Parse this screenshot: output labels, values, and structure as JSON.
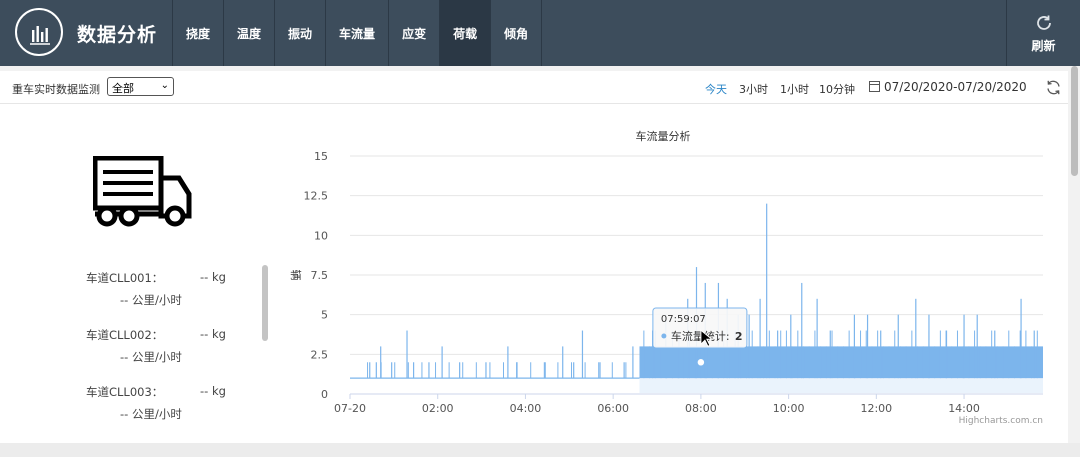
{
  "app": {
    "title": "数据分析",
    "nav": [
      "挠度",
      "温度",
      "振动",
      "车流量",
      "应变",
      "荷载",
      "倾角"
    ],
    "active_nav": "荷载",
    "refresh_label": "刷新"
  },
  "toolbar": {
    "filter_label": "重车实时数据监测",
    "filter_value": "全部",
    "ranges": [
      "今天",
      "3小时",
      "1小时",
      "10分钟"
    ],
    "active_range": "今天",
    "date_range": "07/20/2020-07/20/2020"
  },
  "lanes": [
    {
      "name": "车道CLL001：",
      "weight": "-- kg",
      "speed": "-- 公里/小时"
    },
    {
      "name": "车道CLL002：",
      "weight": "-- kg",
      "speed": "-- 公里/小时"
    },
    {
      "name": "车道CLL003：",
      "weight": "-- kg",
      "speed": "-- 公里/小时"
    }
  ],
  "colors": {
    "topbar": "#3d4d5c",
    "series": "#7cb5ec",
    "active_range": "#2a85c7"
  },
  "chart_data": {
    "type": "area",
    "title": "车流量分析",
    "ylabel": "辆",
    "ylim": [
      0,
      15
    ],
    "yticks": [
      "0",
      "2.5",
      "5",
      "7.5",
      "10",
      "12.5",
      "15"
    ],
    "xticks": [
      "07-20",
      "02:00",
      "04:00",
      "06:00",
      "08:00",
      "10:00",
      "12:00",
      "14:00"
    ],
    "series": [
      {
        "name": "车流量统计"
      }
    ],
    "x_hours_visible": [
      0,
      15.8
    ],
    "baseline": 1,
    "peaks": [
      {
        "x": 0.45,
        "y": 2
      },
      {
        "x": 0.6,
        "y": 2
      },
      {
        "x": 0.7,
        "y": 3
      },
      {
        "x": 0.95,
        "y": 2
      },
      {
        "x": 1.3,
        "y": 4
      },
      {
        "x": 1.45,
        "y": 2
      },
      {
        "x": 1.8,
        "y": 2
      },
      {
        "x": 2.1,
        "y": 3
      },
      {
        "x": 2.5,
        "y": 2
      },
      {
        "x": 3.1,
        "y": 2
      },
      {
        "x": 3.6,
        "y": 3
      },
      {
        "x": 3.8,
        "y": 2
      },
      {
        "x": 4.45,
        "y": 2
      },
      {
        "x": 4.85,
        "y": 3
      },
      {
        "x": 5.1,
        "y": 2
      },
      {
        "x": 5.3,
        "y": 4
      },
      {
        "x": 5.7,
        "y": 2
      },
      {
        "x": 6.25,
        "y": 2
      },
      {
        "x": 6.45,
        "y": 3
      },
      {
        "x": 6.9,
        "y": 4
      },
      {
        "x": 7.2,
        "y": 5
      },
      {
        "x": 7.5,
        "y": 4
      },
      {
        "x": 7.7,
        "y": 6
      },
      {
        "x": 7.9,
        "y": 8
      },
      {
        "x": 8.1,
        "y": 7
      },
      {
        "x": 8.4,
        "y": 7
      },
      {
        "x": 8.6,
        "y": 6
      },
      {
        "x": 8.85,
        "y": 5
      },
      {
        "x": 9.1,
        "y": 5
      },
      {
        "x": 9.35,
        "y": 6
      },
      {
        "x": 9.5,
        "y": 12
      },
      {
        "x": 9.75,
        "y": 4
      },
      {
        "x": 10.05,
        "y": 5
      },
      {
        "x": 10.3,
        "y": 7
      },
      {
        "x": 10.65,
        "y": 6
      },
      {
        "x": 10.95,
        "y": 4
      },
      {
        "x": 11.5,
        "y": 5
      },
      {
        "x": 11.8,
        "y": 5
      },
      {
        "x": 12.1,
        "y": 4
      },
      {
        "x": 12.5,
        "y": 5
      },
      {
        "x": 12.9,
        "y": 6
      },
      {
        "x": 13.2,
        "y": 5
      },
      {
        "x": 13.6,
        "y": 4
      },
      {
        "x": 14.0,
        "y": 5
      },
      {
        "x": 14.3,
        "y": 5
      },
      {
        "x": 14.7,
        "y": 4
      },
      {
        "x": 15.3,
        "y": 6
      },
      {
        "x": 15.6,
        "y": 4
      }
    ],
    "tooltip": {
      "time": "07:59:07",
      "label": "车流量统计: ",
      "value": "2"
    },
    "hover_point": {
      "x": 8.0,
      "y": 2
    },
    "credits": "Highcharts.com.cn",
    "grid": true,
    "legend": "none"
  }
}
